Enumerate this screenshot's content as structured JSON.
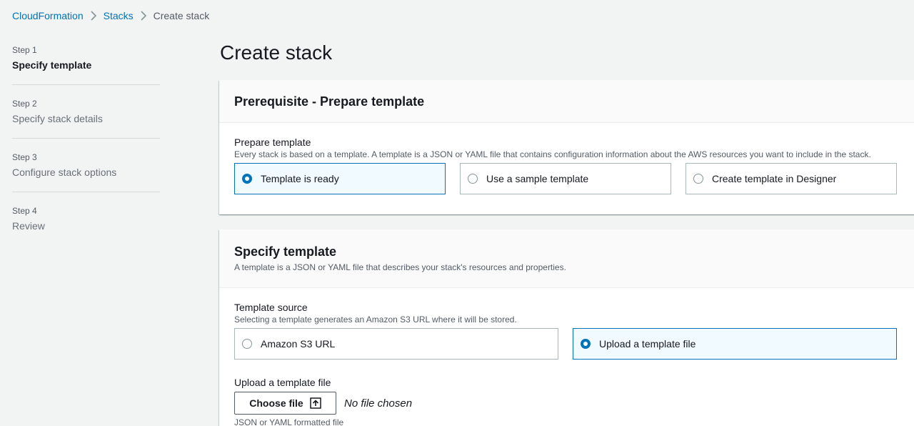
{
  "breadcrumb": {
    "items": [
      "CloudFormation",
      "Stacks",
      "Create stack"
    ]
  },
  "steps": [
    {
      "num": "Step 1",
      "title": "Specify template",
      "active": true
    },
    {
      "num": "Step 2",
      "title": "Specify stack details",
      "active": false
    },
    {
      "num": "Step 3",
      "title": "Configure stack options",
      "active": false
    },
    {
      "num": "Step 4",
      "title": "Review",
      "active": false
    }
  ],
  "page_title": "Create stack",
  "prerequisite": {
    "title": "Prerequisite - Prepare template",
    "field_label": "Prepare template",
    "field_desc": "Every stack is based on a template. A template is a JSON or YAML file that contains configuration information about the AWS resources you want to include in the stack.",
    "options": [
      "Template is ready",
      "Use a sample template",
      "Create template in Designer"
    ],
    "selected": "Template is ready"
  },
  "specify": {
    "title": "Specify template",
    "desc": "A template is a JSON or YAML file that describes your stack's resources and properties.",
    "source_label": "Template source",
    "source_desc": "Selecting a template generates an Amazon S3 URL where it will be stored.",
    "options": [
      "Amazon S3 URL",
      "Upload a template file"
    ],
    "selected": "Upload a template file",
    "upload_label": "Upload a template file",
    "choose_button": "Choose file",
    "no_file": "No file chosen",
    "constraint": "JSON or YAML formatted file"
  },
  "colors": {
    "link": "#0073bb",
    "selected_bg": "#f1faff",
    "page_bg": "#f2f3f3"
  },
  "icons": [
    "chevron-right-icon",
    "upload-icon",
    "radio-button-icon"
  ]
}
